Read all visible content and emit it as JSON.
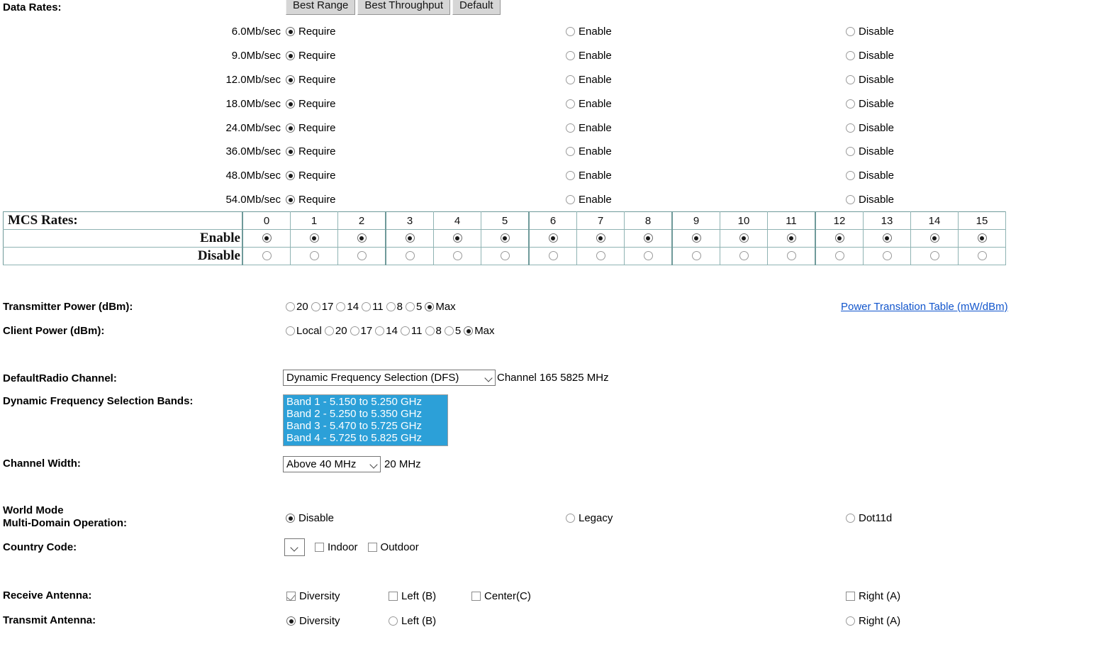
{
  "data_rates": {
    "label": "Data Rates:",
    "buttons": [
      {
        "label": "Best Range",
        "name": "best-range-button"
      },
      {
        "label": "Best Throughput",
        "name": "best-throughput-button"
      },
      {
        "label": "Default",
        "name": "default-button"
      }
    ],
    "column_labels": {
      "require": "Require",
      "enable": "Enable",
      "disable": "Disable"
    },
    "rows": [
      {
        "rate": "6.0Mb/sec",
        "selected": "require"
      },
      {
        "rate": "9.0Mb/sec",
        "selected": "require"
      },
      {
        "rate": "12.0Mb/sec",
        "selected": "require"
      },
      {
        "rate": "18.0Mb/sec",
        "selected": "require"
      },
      {
        "rate": "24.0Mb/sec",
        "selected": "require"
      },
      {
        "rate": "36.0Mb/sec",
        "selected": "require"
      },
      {
        "rate": "48.0Mb/sec",
        "selected": "require"
      },
      {
        "rate": "54.0Mb/sec",
        "selected": "require"
      }
    ]
  },
  "mcs_rates": {
    "label": "MCS Rates:",
    "enable_label": "Enable",
    "disable_label": "Disable",
    "indices": [
      "0",
      "1",
      "2",
      "3",
      "4",
      "5",
      "6",
      "7",
      "8",
      "9",
      "10",
      "11",
      "12",
      "13",
      "14",
      "15"
    ],
    "selected": [
      "enable",
      "enable",
      "enable",
      "enable",
      "enable",
      "enable",
      "enable",
      "enable",
      "enable",
      "enable",
      "enable",
      "enable",
      "enable",
      "enable",
      "enable",
      "enable"
    ]
  },
  "transmitter_power": {
    "label": "Transmitter Power (dBm):",
    "options": [
      "20",
      "17",
      "14",
      "11",
      "8",
      "5",
      "Max"
    ],
    "selected": "Max",
    "link": "Power Translation Table (mW/dBm)"
  },
  "client_power": {
    "label": "Client Power (dBm):",
    "options": [
      "Local",
      "20",
      "17",
      "14",
      "11",
      "8",
      "5",
      "Max"
    ],
    "selected": "Max"
  },
  "radio_channel": {
    "label": "DefaultRadio Channel:",
    "selected": "Dynamic Frequency Selection (DFS)",
    "current": "Channel 165 5825 MHz"
  },
  "dfs_bands": {
    "label": "Dynamic Frequency Selection Bands:",
    "items": [
      "Band 1 - 5.150 to 5.250 GHz",
      "Band 2 - 5.250 to 5.350 GHz",
      "Band 3 - 5.470 to 5.725 GHz",
      "Band 4 - 5.725 to 5.825 GHz"
    ],
    "highlight_color": "#2ca0d8"
  },
  "channel_width": {
    "label": "Channel Width:",
    "selected": "Above 40 MHz",
    "current": "20 MHz"
  },
  "world_mode": {
    "label_line1": "World Mode",
    "label_line2": "Multi-Domain Operation:",
    "options": [
      "Disable",
      "Legacy",
      "Dot11d"
    ],
    "selected": "Disable"
  },
  "country_code": {
    "label": "Country Code:",
    "selected": "",
    "indoor_label": "Indoor",
    "outdoor_label": "Outdoor",
    "indoor_checked": false,
    "outdoor_checked": false
  },
  "receive_antenna": {
    "label": "Receive Antenna:",
    "options": [
      {
        "label": "Diversity",
        "checked": true
      },
      {
        "label": "Left (B)",
        "checked": false
      },
      {
        "label": "Center(C)",
        "checked": false
      },
      {
        "label": "Right (A)",
        "checked": false
      }
    ]
  },
  "transmit_antenna": {
    "label": "Transmit Antenna:",
    "options": [
      {
        "label": "Diversity",
        "selected": true
      },
      {
        "label": "Left (B)",
        "selected": false
      },
      {
        "label": "Right (A)",
        "selected": false
      }
    ]
  }
}
